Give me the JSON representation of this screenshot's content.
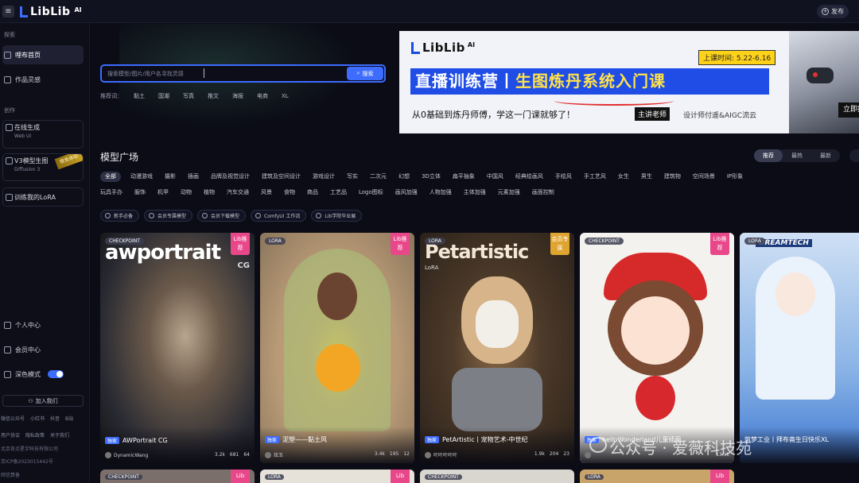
{
  "topbar": {
    "logo_text": "LibLib",
    "logo_ai": "AI",
    "publish_label": "发布"
  },
  "sidebar": {
    "section_explore": "探索",
    "nav_home": "哩布首页",
    "nav_inspiration": "作品灵感",
    "section_create": "创作",
    "online_gen_title": "在线生成",
    "online_gen_sub": "Web UI",
    "v3_title": "V3模型生图",
    "v3_sub": "Diffusion 3",
    "v3_tag": "限免体验",
    "train_lora": "训练我的LoRA",
    "personal_center": "个人中心",
    "member_center": "会员中心",
    "dark_mode": "深色模式",
    "join_us": "加入我们",
    "footer_links_1": [
      "微信公众号",
      "小红书",
      "抖音",
      "B站"
    ],
    "footer_links_2": [
      "用户协议",
      "隐私政策",
      "关于我们"
    ],
    "footer_company": "北京奇点星宇科技有限公司",
    "footer_icp": "京ICP备2023015442号",
    "footer_police": "网信算备"
  },
  "search": {
    "placeholder": "搜索模型/图片/用户名寻找灵感",
    "button": "搜索"
  },
  "hot": {
    "label": "推荐词：",
    "keywords": [
      "黏土",
      "国潮",
      "写真",
      "推文",
      "海报",
      "电商",
      "XL"
    ]
  },
  "banner": {
    "logo_text": "LibLib",
    "logo_ai": "AI",
    "time": "上课时间: 5.22-6.16",
    "headline_a": "直播训练营丨",
    "headline_b": "生图炼丹系统入门课",
    "sub": "从0基础到炼丹师傅，学这一门课就够了！",
    "teacher_label": "主讲老师",
    "teacher_desc": "设计师付遥&AIGC流云",
    "enroll": "立即报"
  },
  "models": {
    "title": "模型广场",
    "sort": [
      "推荐",
      "最热",
      "最新"
    ],
    "categories_row1": [
      "全部",
      "动漫游戏",
      "摄影",
      "插画",
      "品牌及视觉设计",
      "建筑及空间设计",
      "游戏设计",
      "写实",
      "二次元",
      "幻想",
      "3D立体",
      "扁平抽象",
      "中国风",
      "经典绘画风",
      "手绘风",
      "手工艺风",
      "女生",
      "男生",
      "建筑物",
      "空间场景",
      "IP形象"
    ],
    "categories_row2": [
      "玩具手办",
      "服饰",
      "机甲",
      "动物",
      "植物",
      "汽车交通",
      "风景",
      "食物",
      "商品",
      "工艺品",
      "Logo图标",
      "画风加强",
      "人物加强",
      "主体加强",
      "元素加强",
      "画面控制"
    ],
    "chips": [
      "新手必备",
      "会员专属模型",
      "会员下载模型",
      "ComfyUI 工作流",
      "Lib学院毕业展"
    ]
  },
  "cards": [
    {
      "type": "CHECKPOINT",
      "lib": "Lib推荐",
      "cover_text": "awportrait",
      "cover_sub": "CG",
      "badge": "独家",
      "title": "AWPortrait CG",
      "author": "DynamicWang",
      "downloads": "3.2k",
      "likes": "681",
      "comments": "64"
    },
    {
      "type": "LORA",
      "lib": "Lib推荐",
      "badge": "独家",
      "title": "泥塑——黏土风",
      "author": "炫玉",
      "downloads": "3.4k",
      "likes": "195",
      "comments": "12"
    },
    {
      "type": "LORA",
      "lib": "会员专属",
      "cover_text": "Petartistic",
      "cover_sub": "LoRA",
      "badge": "独家",
      "title": "PetArtistic丨宠物艺术-中世纪",
      "author": "叶叶叶叶叶",
      "downloads": "1.9k",
      "likes": "204",
      "comments": "23"
    },
    {
      "type": "CHECKPOINT",
      "lib": "Lib推荐",
      "badge": "独家",
      "title": "helloWonderland儿童插画",
      "author": "",
      "downloads": "13.1k",
      "likes": "",
      "comments": ""
    },
    {
      "type": "LORA",
      "lib": "",
      "cover_text": "DREAMTECH",
      "badge": "",
      "title": "筑梦工业丨拜布斋生日快乐XL",
      "author": "",
      "downloads": "",
      "likes": "",
      "comments": ""
    }
  ],
  "peek_cards": [
    {
      "type": "CHECKPOINT",
      "lib": "Lib"
    },
    {
      "type": "LORA",
      "lib": "Lib"
    },
    {
      "type": "CHECKPOINT",
      "lib": ""
    },
    {
      "type": "LORA",
      "lib": "Lib"
    }
  ],
  "watermark": {
    "text": "公众号 · 爱薇科技苑"
  }
}
